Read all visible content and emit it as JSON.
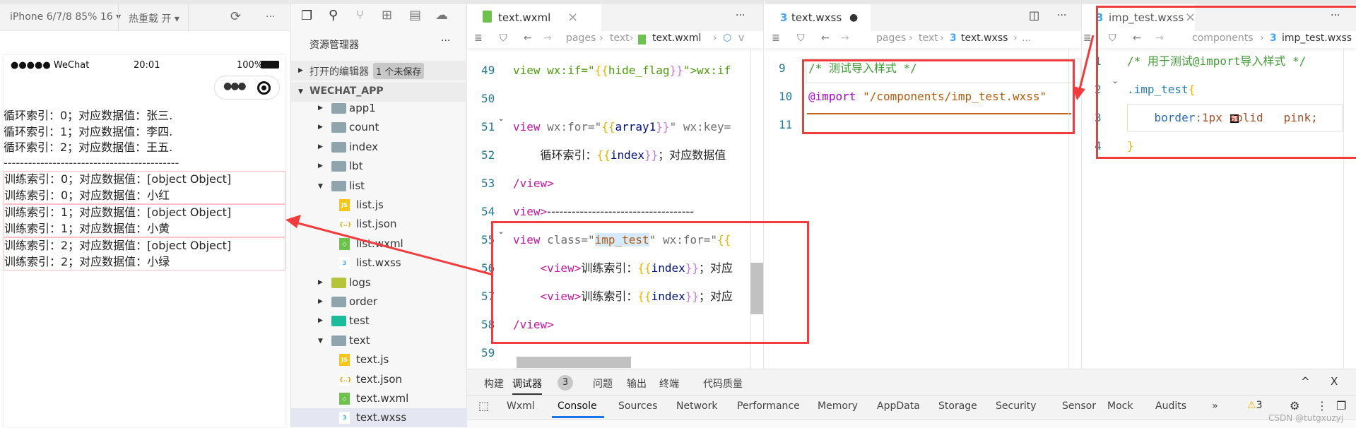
{
  "simulator": {
    "device": "iPhone 6/7/8 85% 16 ▾",
    "hot_reload": "热重载 开 ▾",
    "refresh_icon": "refresh-icon",
    "more": "···",
    "status": {
      "signal": "●●●●● WeChat",
      "time": "20:01",
      "battery": "100%"
    },
    "lines": [
      "循环索引：0；对应数据值：张三.",
      "循环索引：1；对应数据值：李四.",
      "循环索引：2；对应数据值：王五."
    ],
    "divider": "-------------------------------------------",
    "boxes": [
      [
        "训练索引：0；对应数据值：[object Object]",
        "训练索引：0；对应数据值：小红"
      ],
      [
        "训练索引：1；对应数据值：[object Object]",
        "训练索引：1；对应数据值：小黄"
      ],
      [
        "训练索引：2；对应数据值：[object Object]",
        "训练索引：2；对应数据值：小绿"
      ]
    ]
  },
  "explorer": {
    "title": "资源管理器",
    "more": "···",
    "open_editors": "打开的编辑器",
    "unsaved": "1 个未保存",
    "project": "WECHAT_APP",
    "items": [
      {
        "label": "app1",
        "type": "folder",
        "depth": 1,
        "open": false
      },
      {
        "label": "count",
        "type": "folder",
        "depth": 1,
        "open": false
      },
      {
        "label": "index",
        "type": "folder",
        "depth": 1,
        "open": false
      },
      {
        "label": "lbt",
        "type": "folder",
        "depth": 1,
        "open": false
      },
      {
        "label": "list",
        "type": "folder",
        "depth": 1,
        "open": true
      },
      {
        "label": "list.js",
        "type": "js",
        "depth": 2
      },
      {
        "label": "list.json",
        "type": "json",
        "depth": 2
      },
      {
        "label": "list.wxml",
        "type": "wxml",
        "depth": 2
      },
      {
        "label": "list.wxss",
        "type": "wxss",
        "depth": 2
      },
      {
        "label": "logs",
        "type": "folder-logs",
        "depth": 1,
        "open": false
      },
      {
        "label": "order",
        "type": "folder",
        "depth": 1,
        "open": false
      },
      {
        "label": "test",
        "type": "folder-test",
        "depth": 1,
        "open": false
      },
      {
        "label": "text",
        "type": "folder",
        "depth": 1,
        "open": true
      },
      {
        "label": "text.js",
        "type": "js",
        "depth": 2
      },
      {
        "label": "text.json",
        "type": "json",
        "depth": 2
      },
      {
        "label": "text.wxml",
        "type": "wxml",
        "depth": 2
      },
      {
        "label": "text.wxss",
        "type": "wxss",
        "depth": 2,
        "selected": true
      }
    ]
  },
  "editor1": {
    "tab": "text.wxml",
    "close": "×",
    "more": "···",
    "crumbs": [
      "pages",
      "text",
      "text.wxml",
      "v"
    ],
    "lines": [
      {
        "n": "49",
        "t": [
          [
            "view wx:if=\"",
            "c-green"
          ],
          [
            "{{",
            "c-b1"
          ],
          [
            "hide_flag",
            "c-green"
          ],
          [
            "}}",
            "c-b2"
          ],
          [
            "\">wx:if",
            "c-green"
          ]
        ]
      },
      {
        "n": "50",
        "t": []
      },
      {
        "n": "51",
        "fold": true,
        "t": [
          [
            "view ",
            "c-tag"
          ],
          [
            "wx:for=\"",
            "c-attr"
          ],
          [
            "{{",
            "c-b1"
          ],
          [
            "array1",
            "c-var"
          ],
          [
            "}}",
            "c-b2"
          ],
          [
            "\" wx:key=",
            "c-attr"
          ]
        ]
      },
      {
        "n": "52",
        "t": [
          [
            "    ",
            ""
          ],
          [
            "循环索引：",
            "c-zh"
          ],
          [
            "{{",
            "c-b1"
          ],
          [
            "index",
            "c-var"
          ],
          [
            "}}",
            "c-b2"
          ],
          [
            "；对应数据值",
            "c-zh"
          ]
        ]
      },
      {
        "n": "53",
        "t": [
          [
            "/view>",
            "c-tag"
          ]
        ]
      },
      {
        "n": "54",
        "t": [
          [
            "view>",
            "c-tag"
          ],
          [
            "------------------------------------",
            "c-zh"
          ]
        ]
      },
      {
        "n": "55",
        "fold": true,
        "t": [
          [
            "view ",
            "c-tag"
          ],
          [
            "class=\"",
            "c-attr"
          ],
          [
            "imp_test",
            "c-str hl"
          ],
          [
            "\" wx:for=\"",
            "c-attr"
          ],
          [
            "{{",
            "c-b1"
          ]
        ]
      },
      {
        "n": "56",
        "t": [
          [
            "    ",
            ""
          ],
          [
            "<view>",
            "c-tag"
          ],
          [
            "训练索引：",
            "c-zh"
          ],
          [
            "{{",
            "c-b1"
          ],
          [
            "index",
            "c-var"
          ],
          [
            "}}",
            "c-b2"
          ],
          [
            "；对应",
            "c-zh"
          ]
        ]
      },
      {
        "n": "57",
        "t": [
          [
            "    ",
            ""
          ],
          [
            "<view>",
            "c-tag"
          ],
          [
            "训练索引：",
            "c-zh"
          ],
          [
            "{{",
            "c-b1"
          ],
          [
            "index",
            "c-var"
          ],
          [
            "}}",
            "c-b2"
          ],
          [
            "；对应",
            "c-zh"
          ]
        ]
      },
      {
        "n": "58",
        "t": [
          [
            "/view>",
            "c-tag"
          ]
        ]
      },
      {
        "n": "59",
        "t": []
      }
    ]
  },
  "editor2": {
    "tab": "text.wxss",
    "dirty": "●",
    "more": "···",
    "crumbs": [
      "pages",
      "text",
      "text.wxss",
      "..."
    ],
    "lines": [
      {
        "n": "9",
        "t": [
          [
            "/* 测试导入样式 */",
            "c-cm"
          ]
        ]
      },
      {
        "n": "10",
        "t": [
          [
            "@import ",
            "c-at"
          ],
          [
            "\"/components/imp_test.wxss\"",
            "c-str"
          ]
        ]
      },
      {
        "n": "11",
        "t": []
      }
    ]
  },
  "editor3": {
    "tab": "imp_test.wxss",
    "close": "×",
    "more": "···",
    "crumbs": [
      "components",
      "imp_test.wxss"
    ],
    "lines": [
      {
        "n": "1",
        "t": [
          [
            "/* 用于测试@import导入样式 */",
            "c-cm"
          ]
        ]
      },
      {
        "n": "2",
        "fold": true,
        "t": [
          [
            ".imp_test",
            "c-sel"
          ],
          [
            "{",
            "c-b1"
          ]
        ]
      },
      {
        "n": "3",
        "t": [
          [
            "    ",
            ""
          ],
          [
            "border",
            "c-prop"
          ],
          [
            ":",
            "c-attr"
          ],
          [
            "1px solid ",
            "c-val"
          ],
          [
            "  ",
            ""
          ],
          [
            "pink;",
            "c-val"
          ]
        ]
      },
      {
        "n": "4",
        "t": [
          [
            "}",
            "c-b1"
          ]
        ]
      }
    ]
  },
  "bottom": {
    "tabs": [
      "构建",
      "调试器",
      "问题",
      "输出",
      "终端",
      "代码质量"
    ],
    "debugger_badge": "3",
    "devtools": [
      "Wxml",
      "Console",
      "Sources",
      "Network",
      "Performance",
      "Memory",
      "AppData",
      "Storage",
      "Security",
      "Sensor",
      "Mock",
      "Audits",
      "»"
    ],
    "active": "Console",
    "warnings": "3",
    "watermark": "CSDN @tutgxuzyj"
  },
  "colors": {
    "annotation": "#f03c3c",
    "accent": "#1a73e8",
    "pink": "#ffc0cb"
  }
}
